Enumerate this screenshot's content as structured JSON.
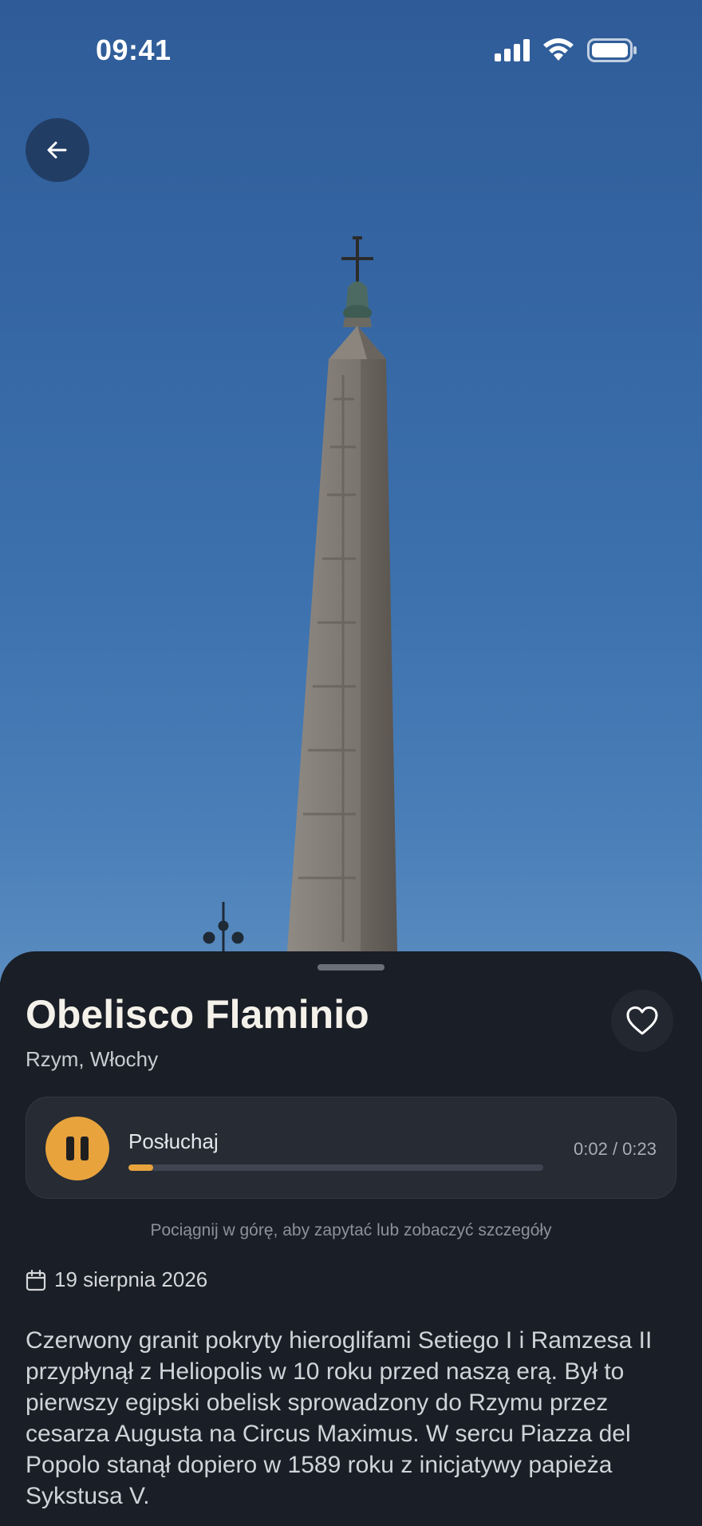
{
  "status_bar": {
    "time": "09:41",
    "icons": [
      "cellular-signal-icon",
      "wifi-icon",
      "battery-icon"
    ]
  },
  "header": {
    "back_icon": "arrow-left-icon"
  },
  "place": {
    "title": "Obelisco Flaminio",
    "location": "Rzym, Włochy",
    "favorite_icon": "heart-icon"
  },
  "audio": {
    "label": "Posłuchaj",
    "time_display": "0:02 / 0:23",
    "progress": 0.06,
    "state": "playing",
    "accent_color": "#e8a33d"
  },
  "hint": "Pociągnij w górę, aby zapytać lub zobaczyć szczegóły",
  "date": {
    "icon": "calendar-icon",
    "text": "19 sierpnia 2026"
  },
  "description": "Czerwony granit pokryty hieroglifami Setiego I i Ramzesa II przypłynął z Heliopolis w 10 roku przed naszą erą. Był to pierwszy egipski obelisk sprowadzony do Rzymu przez cesarza Augusta na Circus Maximus. W sercu Piazza del Popolo stanął dopiero w 1589 roku z inicjatywy papieża Sykstusa V."
}
